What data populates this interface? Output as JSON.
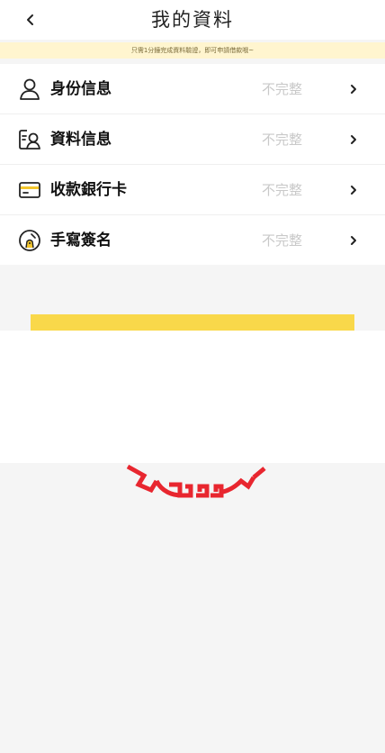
{
  "header": {
    "back_icon": "chevron-left-icon",
    "title": "我的資料"
  },
  "notice": {
    "text": "只需1分鐘完成資料驗證，即可申請借款哦~"
  },
  "menu": {
    "items": [
      {
        "icon": "user-icon",
        "label": "身份信息",
        "status": "不完整",
        "chevron": "chevron-right-icon"
      },
      {
        "icon": "profile-card-icon",
        "label": "資料信息",
        "status": "不完整",
        "chevron": "chevron-right-icon"
      },
      {
        "icon": "credit-card-icon",
        "label": "收款銀行卡",
        "status": "不完整",
        "chevron": "chevron-right-icon"
      },
      {
        "icon": "signature-icon",
        "label": "手寫簽名",
        "status": "不完整",
        "chevron": "chevron-right-icon"
      }
    ]
  },
  "colors": {
    "accent_yellow": "#f9d84a",
    "notice_bg": "#fff5cf",
    "ornament_red": "#e8262f",
    "status_gray": "#c9c9c9"
  },
  "decoration": {
    "ornament": "red-greek-key-ornament"
  }
}
